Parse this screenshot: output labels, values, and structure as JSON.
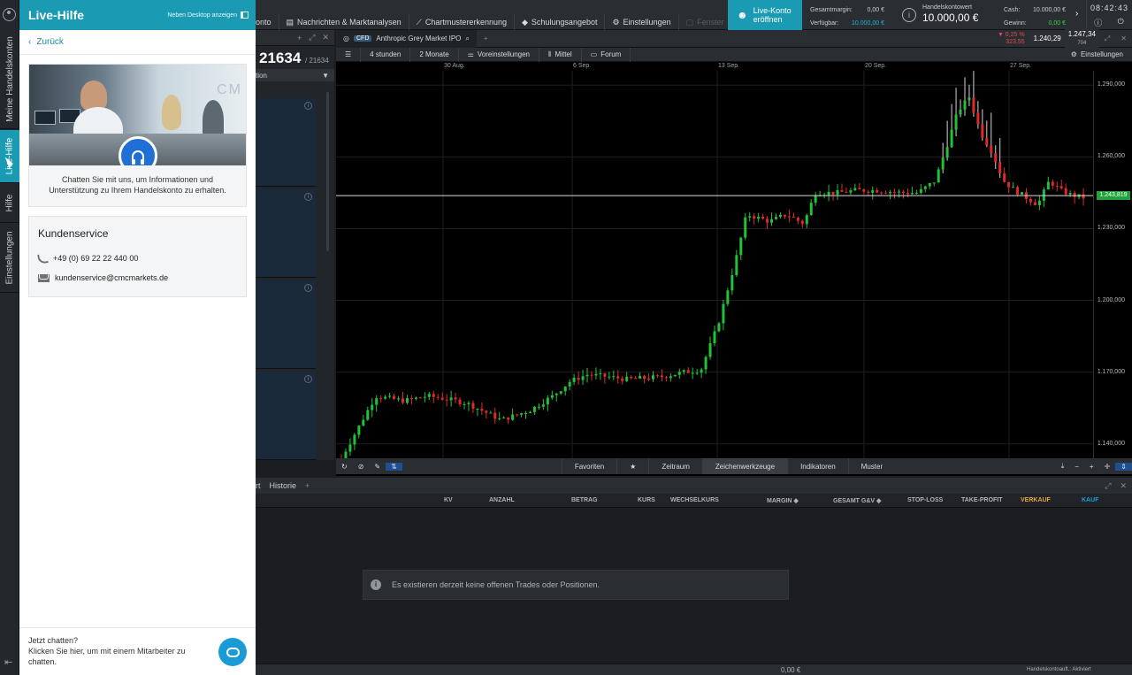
{
  "sidebar": {
    "tabs": [
      {
        "label": "Meine Handelskonten",
        "active": false
      },
      {
        "label": "Live-Hilfe",
        "active": true
      },
      {
        "label": "Hilfe",
        "active": false
      },
      {
        "label": "Einstellungen",
        "active": false
      }
    ],
    "collapse_glyph": "⇤"
  },
  "help_panel": {
    "title": "Live-Hilfe",
    "detach_label": "Neben Desktop anzeigen",
    "back_label": "Zurück",
    "hero_logo": "CM",
    "chat_intro": "Chatten Sie mit uns, um Informationen und Unterstützung zu Ihrem Handelskonto zu erhalten.",
    "service": {
      "title": "Kundenservice",
      "phone": "+49 (0) 69 22 22 440 00",
      "email": "kundenservice@cmcmarkets.de"
    },
    "chat_now": {
      "title": "Jetzt chatten?",
      "text": "Klicken Sie hier, um mit einem Mitarbeiter zu chatten."
    }
  },
  "topbar": {
    "nav": [
      {
        "label": "onto",
        "icon": ""
      },
      {
        "label": "Nachrichten & Marktanalysen",
        "icon": "▤"
      },
      {
        "label": "Chartmustererkennung",
        "icon": "⟋"
      },
      {
        "label": "Schulungsangebot",
        "icon": "◆"
      },
      {
        "label": "Einstellungen",
        "icon": "⚙"
      },
      {
        "label": "Fenster",
        "icon": "▢"
      }
    ],
    "live_account": {
      "line1": "Live-Konto",
      "line2": "eröffnen"
    },
    "margin": {
      "label1": "Gesamtmargin:",
      "value1": "0,00 €",
      "label2": "Verfügbar:",
      "value2": "10.000,00 €"
    },
    "account_value": {
      "label": "Handelskontowert",
      "value": "10.000,00 €"
    },
    "cash": {
      "label1": "Cash:",
      "value1": "10.000,00 €",
      "label2": "Gewinn:",
      "value2": "0,00 €"
    },
    "clock": "08:42:43",
    "colors": {
      "accent": "#1a9bb3",
      "profit": "#3ecf4a"
    }
  },
  "left_pane": {
    "price": "21634",
    "price_small": "/ 21634",
    "selector": "tion"
  },
  "chart_panel": {
    "instrument_badge": "CFD",
    "instrument": "Anthropic Grey Market IPO",
    "change_pct": "▼ 0,25 %",
    "change_abs": "323,55",
    "sell": "1.240,29",
    "buy": "1.247,34",
    "spread": "704",
    "toolbar": {
      "interval": "4 stunden",
      "range": "2 Monate",
      "presets": "Voreinstellungen",
      "average": "Mittel",
      "forum": "Forum",
      "settings": "Einstellungen"
    },
    "bottom": {
      "favorites": "Favoriten",
      "timeframe": "Zeitraum",
      "drawing": "Zeichenwerkzeuge",
      "indicators": "Indikatoren",
      "patterns": "Muster"
    },
    "last_price_label": "1.243,819"
  },
  "chart_data": {
    "type": "candlestick",
    "x_labels": [
      "30 Aug.",
      "6 Sep.",
      "13 Sep.",
      "20 Sep.",
      "27 Sep."
    ],
    "y_ticks": [
      "1.290,000",
      "1.260,000",
      "1.230,000",
      "1.200,000",
      "1.170,000",
      "1.140,000"
    ],
    "ylim": [
      1134,
      1296
    ],
    "last_price": 1243.819,
    "up_color": "#21c23a",
    "down_color": "#e02a2a",
    "path": [
      [
        0,
        1134
      ],
      [
        6,
        1160
      ],
      [
        11,
        1158
      ],
      [
        15,
        1160
      ],
      [
        18,
        1159
      ],
      [
        22,
        1157
      ],
      [
        28,
        1150
      ],
      [
        33,
        1154
      ],
      [
        37,
        1160
      ],
      [
        40,
        1166
      ],
      [
        43,
        1169
      ],
      [
        47,
        1168
      ],
      [
        50,
        1167
      ],
      [
        56,
        1168
      ],
      [
        60,
        1170
      ],
      [
        63,
        1171
      ],
      [
        66,
        1190
      ],
      [
        69,
        1216
      ],
      [
        71,
        1236
      ],
      [
        75,
        1233
      ],
      [
        78,
        1236
      ],
      [
        81,
        1232
      ],
      [
        83,
        1245
      ],
      [
        87,
        1245
      ],
      [
        90,
        1246
      ],
      [
        94,
        1246
      ],
      [
        98,
        1245
      ],
      [
        101,
        1245
      ],
      [
        104,
        1250
      ],
      [
        106,
        1264
      ],
      [
        108,
        1279
      ],
      [
        110,
        1285
      ],
      [
        112,
        1270
      ],
      [
        114,
        1262
      ],
      [
        116,
        1250
      ],
      [
        118,
        1246
      ],
      [
        120,
        1243
      ],
      [
        122,
        1240
      ],
      [
        124,
        1250
      ],
      [
        126,
        1246
      ],
      [
        128,
        1244
      ],
      [
        130,
        1243
      ]
    ]
  },
  "orders": {
    "tabs": [
      "rt",
      "Historie",
      "+"
    ],
    "columns": [
      "KV",
      "ANZAHL",
      "BETRAG",
      "KURS",
      "WECHSELKURS",
      "MARGIN ◆",
      "GESAMT G&V ◆",
      "STOP-LOSS",
      "TAKE-PROFIT",
      "VERKAUF",
      "KAUF"
    ],
    "sell_color": "#e8a53a",
    "buy_color": "#1a9bd6",
    "empty_notice": "Es existieren derzeit keine offenen Trades oder Positionen."
  },
  "status": {
    "total": "0,00 €",
    "right": "Handelskontoauft.: Aktiviert"
  }
}
